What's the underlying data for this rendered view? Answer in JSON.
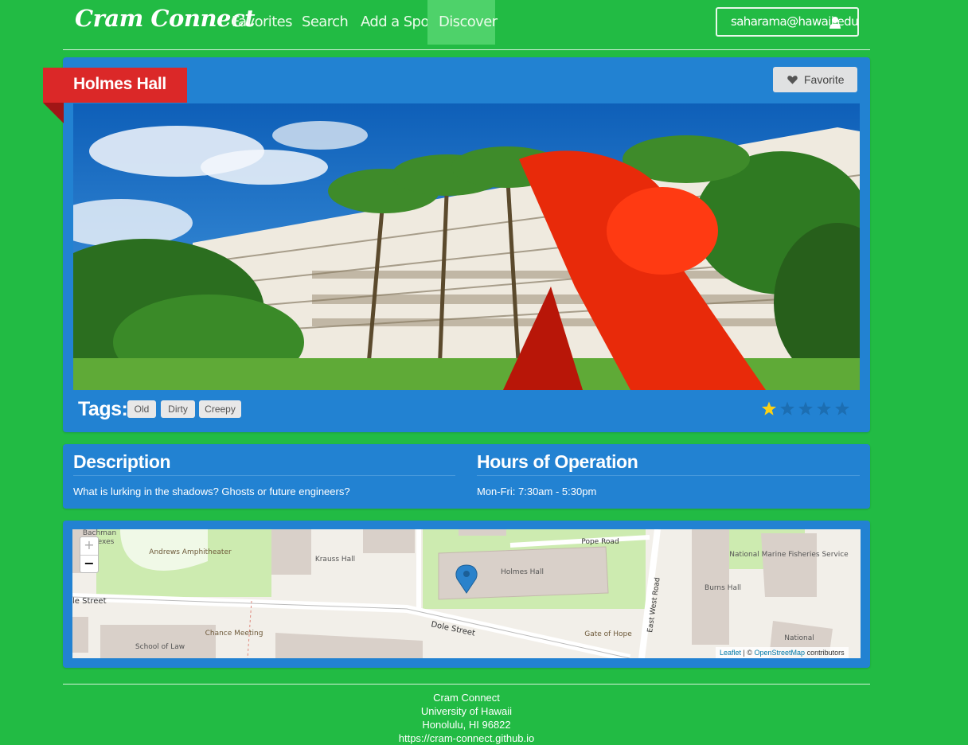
{
  "navbar": {
    "brand": "Cram Connect",
    "items": [
      {
        "label": "Favorites"
      },
      {
        "label": "Search"
      },
      {
        "label": "Add a Spot"
      },
      {
        "label": "Discover",
        "active": true
      }
    ],
    "user_email": "saharama@hawaii.edu",
    "user_icon": "user-icon"
  },
  "spot": {
    "title": "Holmes Hall",
    "favorite_label": "Favorite",
    "favorite_icon": "heart-icon",
    "tags_label": "Tags:",
    "tags": [
      "Old",
      "Dirty",
      "Creepy"
    ],
    "rating": 1,
    "rating_max": 5
  },
  "details": {
    "description_title": "Description",
    "description_text": "What is lurking in the shadows? Ghosts or future engineers?",
    "hours_title": "Hours of Operation",
    "hours_text": "Mon-Fri: 7:30am - 5:30pm"
  },
  "map": {
    "zoom_in": "+",
    "zoom_out": "−",
    "labels": {
      "bachman": "Bachman",
      "annexes": "exes",
      "andrews": "Andrews Amphitheater",
      "krauss": "Krauss Hall",
      "pope_road": "Pope Road",
      "holmes": "Holmes Hall",
      "marine": "National Marine Fisheries Service",
      "burns": "Burns Hall",
      "east_west": "East West Road",
      "dole_street_left": "le Street",
      "dole_street": "Dole Street",
      "chance": "Chance Meeting",
      "gate": "Gate of Hope",
      "school": "School of Law",
      "national": "National"
    },
    "attribution_leaflet": "Leaflet",
    "attribution_sep": " | © ",
    "attribution_osm": "OpenStreetMap",
    "attribution_tail": " contributors"
  },
  "footer": {
    "line1": "Cram Connect",
    "line2": "University of Hawaii",
    "line3": "Honolulu, HI 96822",
    "line4": "https://cram-connect.github.io"
  },
  "colors": {
    "background": "#22bb44",
    "panel": "#2282d2",
    "ribbon": "#db2828",
    "star_active": "#fbd115"
  }
}
